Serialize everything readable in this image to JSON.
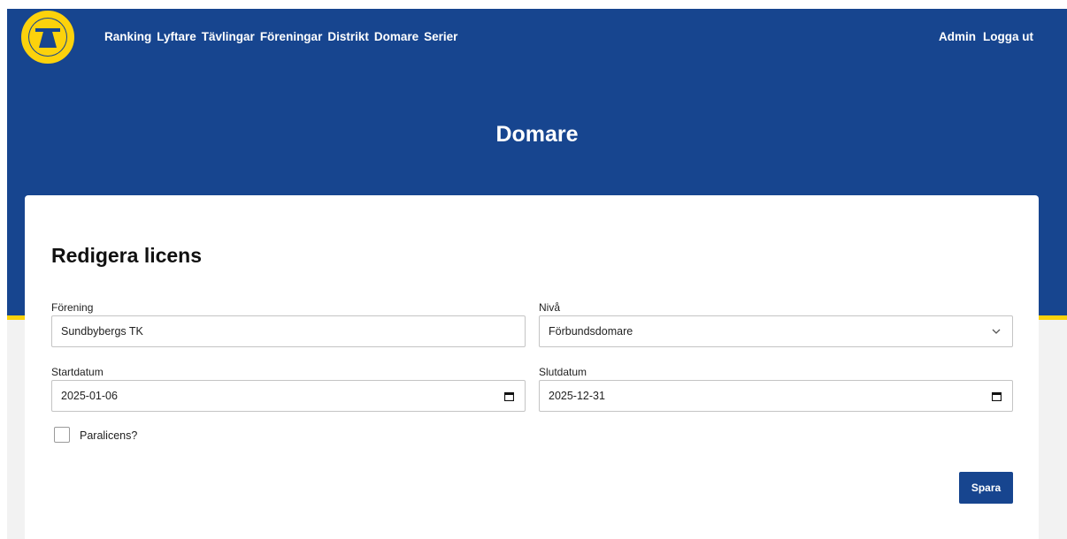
{
  "nav": {
    "items": [
      "Ranking",
      "Lyftare",
      "Tävlingar",
      "Föreningar",
      "Distrikt",
      "Domare",
      "Serier"
    ],
    "user": [
      "Admin",
      "Logga ut"
    ]
  },
  "page": {
    "title": "Domare"
  },
  "form": {
    "title": "Redigera licens",
    "forening": {
      "label": "Förening",
      "value": "Sundbybergs TK"
    },
    "niva": {
      "label": "Nivå",
      "value": "Förbundsdomare"
    },
    "startdatum": {
      "label": "Startdatum",
      "value": "2025-01-06"
    },
    "slutdatum": {
      "label": "Slutdatum",
      "value": "2025-12-31"
    },
    "paralicens": {
      "label": "Paralicens?",
      "checked": false
    },
    "save_label": "Spara"
  },
  "colors": {
    "primary": "#17458f",
    "accent": "#fcd20c",
    "background": "#f2f2f2"
  },
  "icons": {
    "logo": "federation-logo",
    "select": "chevron-down-icon",
    "date": "calendar-icon"
  }
}
